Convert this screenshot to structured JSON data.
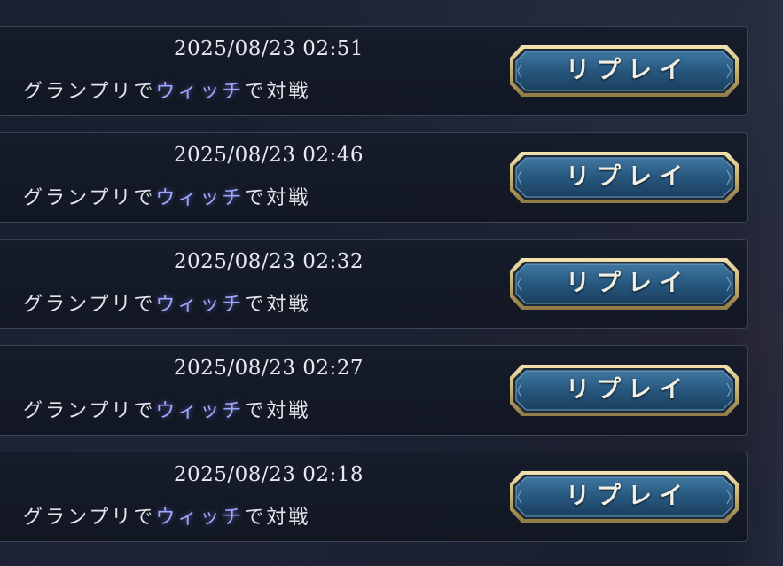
{
  "battle_history": {
    "entries": [
      {
        "datetime": "2025/08/23 02:51",
        "desc_prefix": "グランプリで",
        "class_name": "ウィッチ",
        "desc_suffix": "で対戦",
        "button_label": "リプレイ"
      },
      {
        "datetime": "2025/08/23 02:46",
        "desc_prefix": "グランプリで",
        "class_name": "ウィッチ",
        "desc_suffix": "で対戦",
        "button_label": "リプレイ"
      },
      {
        "datetime": "2025/08/23 02:32",
        "desc_prefix": "グランプリで",
        "class_name": "ウィッチ",
        "desc_suffix": "で対戦",
        "button_label": "リプレイ"
      },
      {
        "datetime": "2025/08/23 02:27",
        "desc_prefix": "グランプリで",
        "class_name": "ウィッチ",
        "desc_suffix": "で対戦",
        "button_label": "リプレイ"
      },
      {
        "datetime": "2025/08/23 02:18",
        "desc_prefix": "グランプリで",
        "class_name": "ウィッチ",
        "desc_suffix": "で対戦",
        "button_label": "リプレイ"
      }
    ]
  },
  "colors": {
    "class_highlight": "#9fa6ff",
    "button_gold": "#d8c48c",
    "button_blue": "#2c5f86"
  }
}
